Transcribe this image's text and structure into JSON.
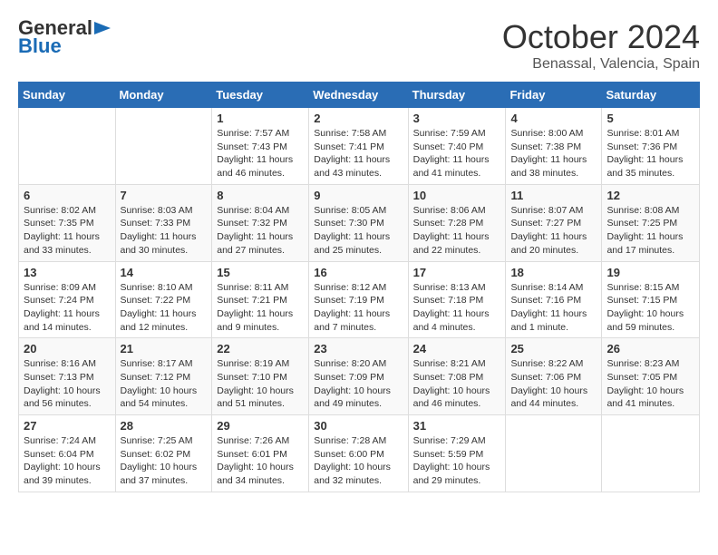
{
  "header": {
    "logo_general": "General",
    "logo_blue": "Blue",
    "month": "October 2024",
    "location": "Benassal, Valencia, Spain"
  },
  "days_of_week": [
    "Sunday",
    "Monday",
    "Tuesday",
    "Wednesday",
    "Thursday",
    "Friday",
    "Saturday"
  ],
  "weeks": [
    [
      {
        "day": "",
        "content": ""
      },
      {
        "day": "",
        "content": ""
      },
      {
        "day": "1",
        "content": "Sunrise: 7:57 AM\nSunset: 7:43 PM\nDaylight: 11 hours and 46 minutes."
      },
      {
        "day": "2",
        "content": "Sunrise: 7:58 AM\nSunset: 7:41 PM\nDaylight: 11 hours and 43 minutes."
      },
      {
        "day": "3",
        "content": "Sunrise: 7:59 AM\nSunset: 7:40 PM\nDaylight: 11 hours and 41 minutes."
      },
      {
        "day": "4",
        "content": "Sunrise: 8:00 AM\nSunset: 7:38 PM\nDaylight: 11 hours and 38 minutes."
      },
      {
        "day": "5",
        "content": "Sunrise: 8:01 AM\nSunset: 7:36 PM\nDaylight: 11 hours and 35 minutes."
      }
    ],
    [
      {
        "day": "6",
        "content": "Sunrise: 8:02 AM\nSunset: 7:35 PM\nDaylight: 11 hours and 33 minutes."
      },
      {
        "day": "7",
        "content": "Sunrise: 8:03 AM\nSunset: 7:33 PM\nDaylight: 11 hours and 30 minutes."
      },
      {
        "day": "8",
        "content": "Sunrise: 8:04 AM\nSunset: 7:32 PM\nDaylight: 11 hours and 27 minutes."
      },
      {
        "day": "9",
        "content": "Sunrise: 8:05 AM\nSunset: 7:30 PM\nDaylight: 11 hours and 25 minutes."
      },
      {
        "day": "10",
        "content": "Sunrise: 8:06 AM\nSunset: 7:28 PM\nDaylight: 11 hours and 22 minutes."
      },
      {
        "day": "11",
        "content": "Sunrise: 8:07 AM\nSunset: 7:27 PM\nDaylight: 11 hours and 20 minutes."
      },
      {
        "day": "12",
        "content": "Sunrise: 8:08 AM\nSunset: 7:25 PM\nDaylight: 11 hours and 17 minutes."
      }
    ],
    [
      {
        "day": "13",
        "content": "Sunrise: 8:09 AM\nSunset: 7:24 PM\nDaylight: 11 hours and 14 minutes."
      },
      {
        "day": "14",
        "content": "Sunrise: 8:10 AM\nSunset: 7:22 PM\nDaylight: 11 hours and 12 minutes."
      },
      {
        "day": "15",
        "content": "Sunrise: 8:11 AM\nSunset: 7:21 PM\nDaylight: 11 hours and 9 minutes."
      },
      {
        "day": "16",
        "content": "Sunrise: 8:12 AM\nSunset: 7:19 PM\nDaylight: 11 hours and 7 minutes."
      },
      {
        "day": "17",
        "content": "Sunrise: 8:13 AM\nSunset: 7:18 PM\nDaylight: 11 hours and 4 minutes."
      },
      {
        "day": "18",
        "content": "Sunrise: 8:14 AM\nSunset: 7:16 PM\nDaylight: 11 hours and 1 minute."
      },
      {
        "day": "19",
        "content": "Sunrise: 8:15 AM\nSunset: 7:15 PM\nDaylight: 10 hours and 59 minutes."
      }
    ],
    [
      {
        "day": "20",
        "content": "Sunrise: 8:16 AM\nSunset: 7:13 PM\nDaylight: 10 hours and 56 minutes."
      },
      {
        "day": "21",
        "content": "Sunrise: 8:17 AM\nSunset: 7:12 PM\nDaylight: 10 hours and 54 minutes."
      },
      {
        "day": "22",
        "content": "Sunrise: 8:19 AM\nSunset: 7:10 PM\nDaylight: 10 hours and 51 minutes."
      },
      {
        "day": "23",
        "content": "Sunrise: 8:20 AM\nSunset: 7:09 PM\nDaylight: 10 hours and 49 minutes."
      },
      {
        "day": "24",
        "content": "Sunrise: 8:21 AM\nSunset: 7:08 PM\nDaylight: 10 hours and 46 minutes."
      },
      {
        "day": "25",
        "content": "Sunrise: 8:22 AM\nSunset: 7:06 PM\nDaylight: 10 hours and 44 minutes."
      },
      {
        "day": "26",
        "content": "Sunrise: 8:23 AM\nSunset: 7:05 PM\nDaylight: 10 hours and 41 minutes."
      }
    ],
    [
      {
        "day": "27",
        "content": "Sunrise: 7:24 AM\nSunset: 6:04 PM\nDaylight: 10 hours and 39 minutes."
      },
      {
        "day": "28",
        "content": "Sunrise: 7:25 AM\nSunset: 6:02 PM\nDaylight: 10 hours and 37 minutes."
      },
      {
        "day": "29",
        "content": "Sunrise: 7:26 AM\nSunset: 6:01 PM\nDaylight: 10 hours and 34 minutes."
      },
      {
        "day": "30",
        "content": "Sunrise: 7:28 AM\nSunset: 6:00 PM\nDaylight: 10 hours and 32 minutes."
      },
      {
        "day": "31",
        "content": "Sunrise: 7:29 AM\nSunset: 5:59 PM\nDaylight: 10 hours and 29 minutes."
      },
      {
        "day": "",
        "content": ""
      },
      {
        "day": "",
        "content": ""
      }
    ]
  ]
}
